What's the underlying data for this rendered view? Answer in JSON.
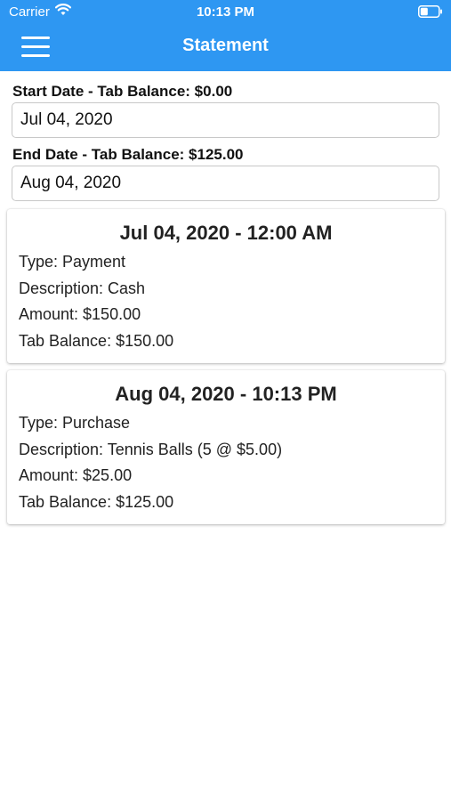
{
  "status_bar": {
    "carrier": "Carrier",
    "time": "10:13 PM"
  },
  "nav": {
    "title": "Statement",
    "menu_icon": "hamburger-menu-icon"
  },
  "filters": {
    "start_label": "Start Date - Tab Balance: $0.00",
    "start_value": "Jul 04, 2020",
    "end_label": "End Date - Tab Balance: $125.00",
    "end_value": "Aug 04, 2020"
  },
  "transactions": [
    {
      "datetime": "Jul 04, 2020 - 12:00 AM",
      "type": "Type: Payment",
      "description": "Description: Cash",
      "amount": "Amount: $150.00",
      "tab_balance": "Tab Balance: $150.00"
    },
    {
      "datetime": "Aug 04, 2020 - 10:13 PM",
      "type": "Type: Purchase",
      "description": "Description: Tennis Balls (5 @ $5.00)",
      "amount": "Amount: $25.00",
      "tab_balance": "Tab Balance: $125.00"
    }
  ],
  "colors": {
    "header_bg": "#2e97f2",
    "header_text": "#ffffff"
  }
}
